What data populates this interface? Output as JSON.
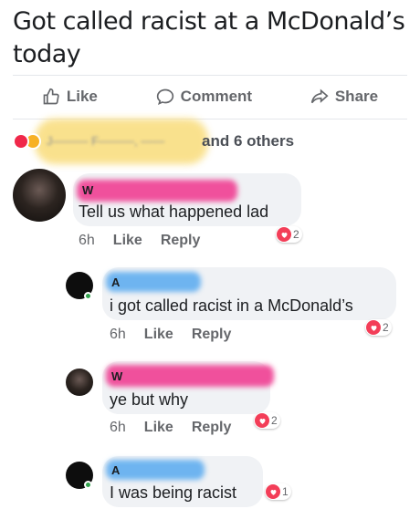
{
  "post": {
    "text": "Got called racist at a McDonald’s today"
  },
  "actions": {
    "like": "Like",
    "comment": "Comment",
    "share": "Share"
  },
  "reactions": {
    "others_text": "and 6 others",
    "blurred_names": "J——— F———, ——"
  },
  "colors": {
    "heart": "#f33e58",
    "pink_marker": "#f0509c",
    "blue_marker": "#6eb4f0",
    "yellow_marker": "#f9dc7a"
  },
  "comments": [
    {
      "initial": "W",
      "text": "Tell us what happened lad",
      "time": "6h",
      "like": "Like",
      "reply": "Reply",
      "reaction_count": "2",
      "marker": "pink"
    },
    {
      "initial": "A",
      "text": "i got called racist in a McDonald’s",
      "time": "6h",
      "like": "Like",
      "reply": "Reply",
      "reaction_count": "2",
      "marker": "blue"
    },
    {
      "initial": "W",
      "text": "ye but why",
      "time": "6h",
      "like": "Like",
      "reply": "Reply",
      "reaction_count": "2",
      "marker": "pink"
    },
    {
      "initial": "A",
      "text": "I was being racist",
      "reaction_count": "1",
      "marker": "blue"
    }
  ]
}
